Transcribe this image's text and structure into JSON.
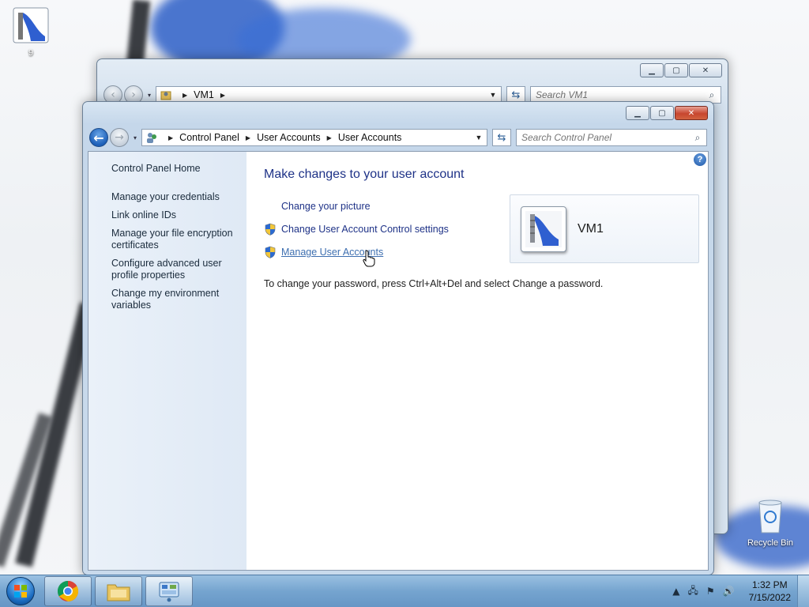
{
  "desktop": {
    "icons": [
      {
        "label": "9"
      },
      {
        "label": "Recycle Bin"
      }
    ]
  },
  "back_window": {
    "address": {
      "crumbs": [
        "VM1"
      ]
    },
    "search": {
      "placeholder": "Search VM1"
    }
  },
  "front_window": {
    "address": {
      "crumbs": [
        "Control Panel",
        "User Accounts",
        "User Accounts"
      ]
    },
    "search": {
      "placeholder": "Search Control Panel"
    },
    "left_pane": {
      "home": "Control Panel Home",
      "links": [
        "Manage your credentials",
        "Link online IDs",
        "Manage your file encryption certificates",
        "Configure advanced user profile properties",
        "Change my environment variables"
      ]
    },
    "main": {
      "heading": "Make changes to your user account",
      "tasks": [
        {
          "label": "Change your picture",
          "shield": false
        },
        {
          "label": "Change User Account Control settings",
          "shield": true
        },
        {
          "label": "Manage User Accounts",
          "shield": true,
          "hover": true
        }
      ],
      "note": "To change your password, press Ctrl+Alt+Del and select Change a password.",
      "user": {
        "name": "VM1"
      }
    }
  },
  "taskbar": {
    "clock": {
      "time": "1:32 PM",
      "date": "7/15/2022"
    }
  },
  "colors": {
    "link": "#1e3287",
    "hover_link": "#3e6fb0",
    "accent": "#1c5fb8"
  }
}
